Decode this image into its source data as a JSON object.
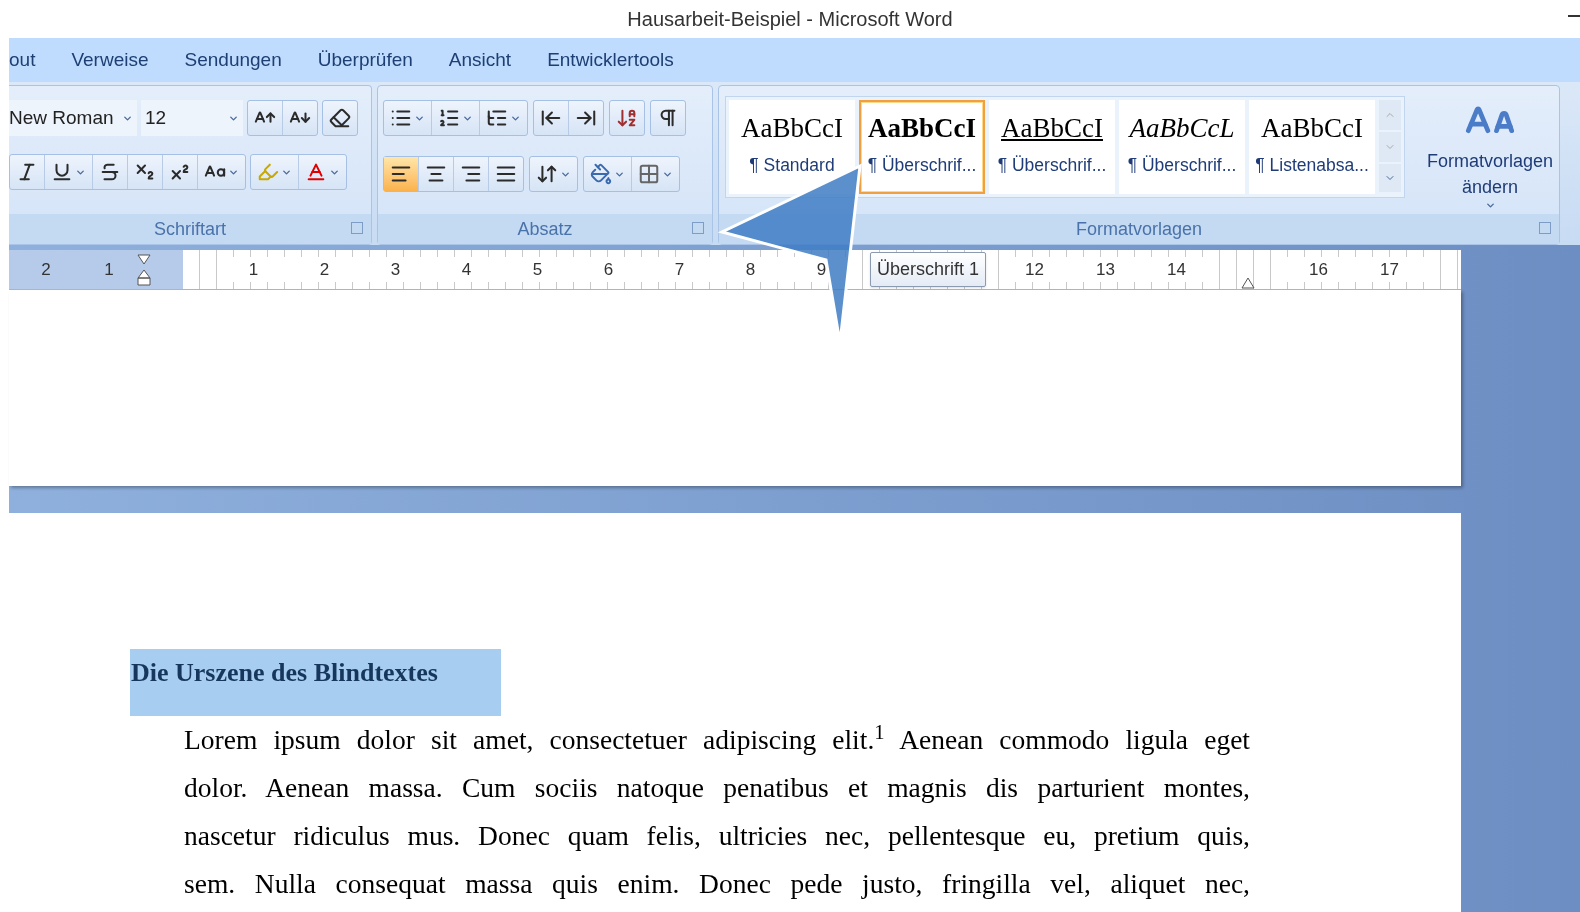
{
  "window": {
    "title": "Hausarbeit-Beispiel - Microsoft Word"
  },
  "tabs": [
    "out",
    "Verweise",
    "Sendungen",
    "Überprüfen",
    "Ansicht",
    "Entwicklertools"
  ],
  "ribbon": {
    "font": {
      "label": "Schriftart",
      "font_name": "New Roman",
      "font_size": "12"
    },
    "paragraph": {
      "label": "Absatz",
      "alignments": [
        {
          "kind": "left",
          "selected": true
        },
        {
          "kind": "center",
          "selected": false
        },
        {
          "kind": "right",
          "selected": false
        },
        {
          "kind": "justify",
          "selected": false
        }
      ]
    },
    "styles": {
      "label": "Formatvorlagen",
      "change_button": "Formatvorlagen ändern",
      "items": [
        {
          "kind": "normal",
          "preview": "AaBbCcI",
          "label": "¶ Standard",
          "selected": false
        },
        {
          "kind": "bold",
          "preview": "AaBbCcI",
          "label": "¶ Überschrif...",
          "selected": true
        },
        {
          "kind": "underline",
          "preview": "AaBbCcI",
          "label": "¶ Überschrif...",
          "selected": false
        },
        {
          "kind": "italic",
          "preview": "AaBbCcL",
          "label": "¶ Überschrif...",
          "selected": false
        },
        {
          "kind": "normal",
          "preview": "AaBbCcI",
          "label": "¶ Listenabsa...",
          "selected": false
        }
      ]
    }
  },
  "ruler": {
    "left": [
      {
        "kind": "number",
        "label": "2"
      },
      {
        "kind": "number",
        "label": "1"
      }
    ],
    "right": [
      {
        "kind": "number",
        "label": "1"
      },
      {
        "kind": "number",
        "label": "2"
      },
      {
        "kind": "number",
        "label": "3"
      },
      {
        "kind": "number",
        "label": "4"
      },
      {
        "kind": "number",
        "label": "5"
      },
      {
        "kind": "number",
        "label": "6"
      },
      {
        "kind": "number",
        "label": "7"
      },
      {
        "kind": "number",
        "label": "8"
      },
      {
        "kind": "number",
        "label": "9"
      },
      {
        "kind": "tooltip",
        "label": "Überschrift 1"
      },
      {
        "kind": "number",
        "label": "12"
      },
      {
        "kind": "number",
        "label": "13"
      },
      {
        "kind": "number",
        "label": "14"
      },
      {
        "kind": "marker"
      },
      {
        "kind": "number",
        "label": "16"
      },
      {
        "kind": "number",
        "label": "17"
      }
    ]
  },
  "document": {
    "heading": {
      "text": "Die Urszene des Blindtextes",
      "selected": true
    },
    "paragraph_lines": [
      "Lorem ipsum dolor sit amet, consectetuer adipiscing elit.$^{1}$ Aenean commodo ligula eget",
      "dolor. Aenean massa. Cum sociis natoque penatibus et magnis dis parturient montes,",
      "nascetur ridiculus mus. Donec quam felis, ultricies nec, pellentesque eu, pretium quis,",
      "sem. Nulla consequat massa quis enim. Donec pede justo, fringilla vel, aliquet nec,"
    ]
  }
}
